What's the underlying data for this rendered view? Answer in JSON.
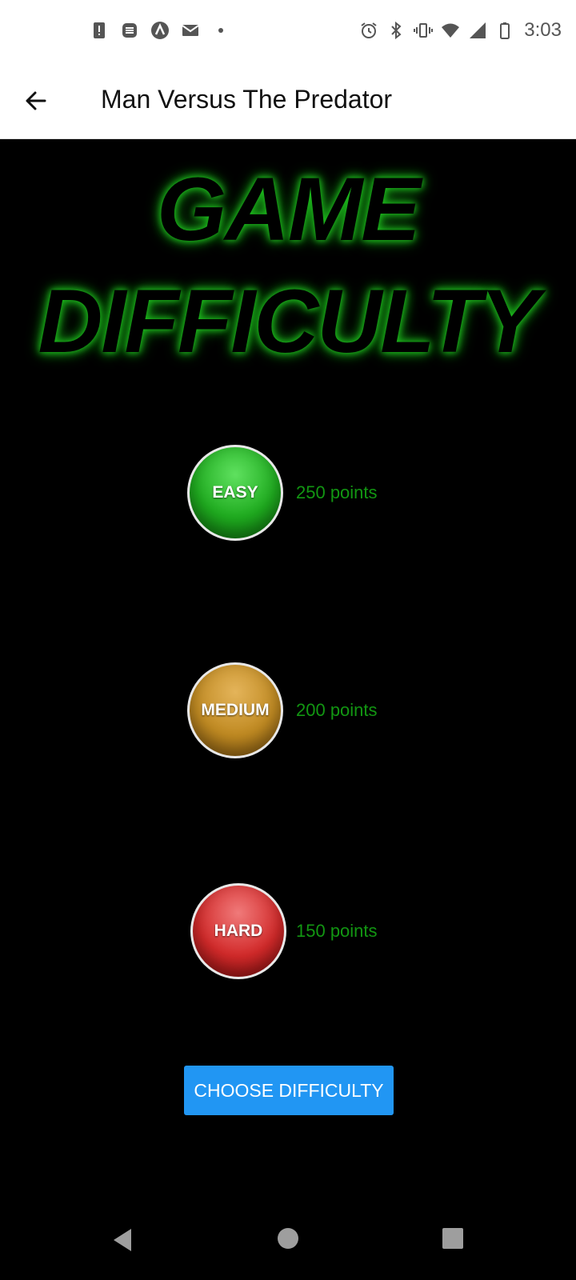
{
  "status_bar": {
    "time": "3:03",
    "left_icons": [
      "alert-icon",
      "news-icon",
      "app-icon",
      "mail-icon",
      "dot-icon"
    ],
    "right_icons": [
      "alarm-icon",
      "bluetooth-icon",
      "vibrate-icon",
      "wifi-icon",
      "signal-icon",
      "battery-icon"
    ]
  },
  "app_bar": {
    "title": "Man Versus The Predator"
  },
  "heading": {
    "line1": "GAME",
    "line2": "DIFFICULTY"
  },
  "difficulties": [
    {
      "label": "EASY",
      "points": "250 points"
    },
    {
      "label": "MEDIUM",
      "points": "200 points"
    },
    {
      "label": "HARD",
      "points": "150 points"
    }
  ],
  "choose_button": {
    "label": "CHOOSE DIFFICULTY"
  },
  "colors": {
    "background": "#000000",
    "points_text": "#129612",
    "heading_glow": "#1fbf1f",
    "button": "#2196f3"
  }
}
